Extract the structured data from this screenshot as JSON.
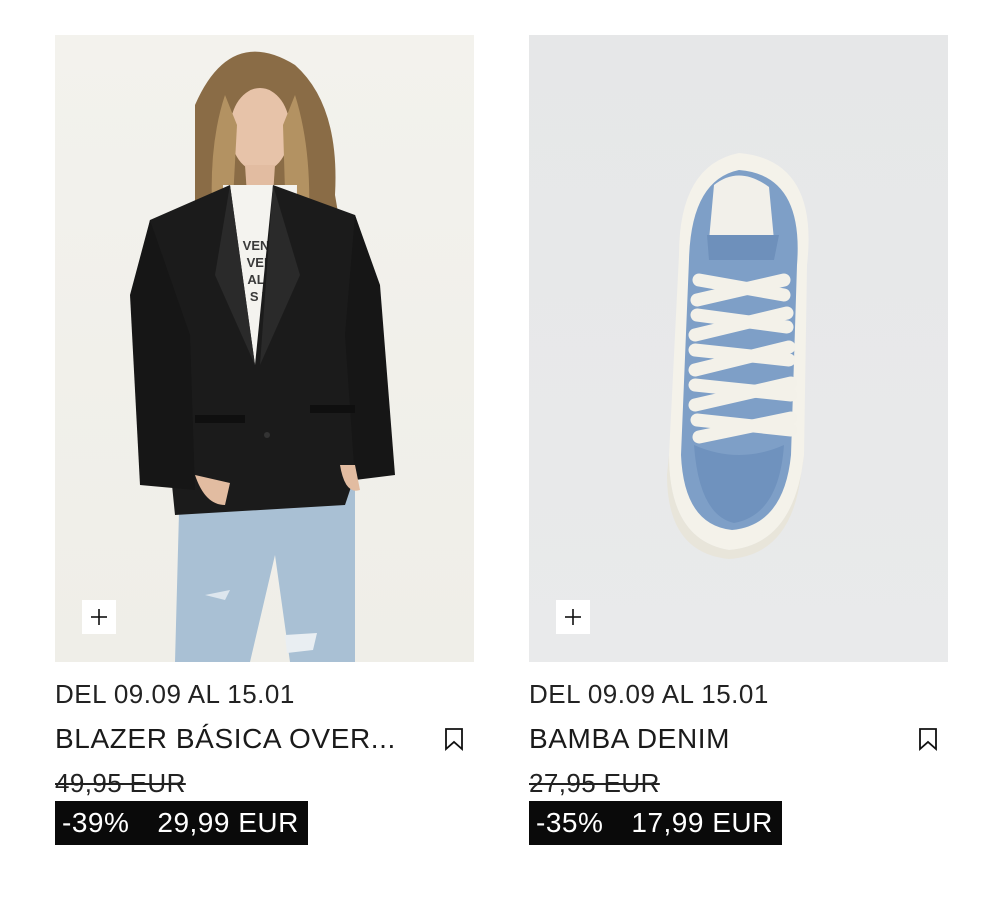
{
  "products": [
    {
      "date_range": "DEL 09.09 AL 15.01",
      "title": "BLAZER BÁSICA OVER...",
      "old_price": "49,95 EUR",
      "discount": "-39%",
      "sale_price": "29,99 EUR",
      "image": "blazer-model-photo"
    },
    {
      "date_range": "DEL 09.09 AL 15.01",
      "title": "BAMBA DENIM",
      "old_price": "27,95 EUR",
      "discount": "-35%",
      "sale_price": "17,99 EUR",
      "image": "denim-sneaker-photo"
    }
  ],
  "icons": {
    "add": "plus-icon",
    "save": "bookmark-icon"
  },
  "colors": {
    "sale_bg": "#0a0a0a",
    "sale_text": "#ffffff",
    "text": "#1a1a1a"
  }
}
